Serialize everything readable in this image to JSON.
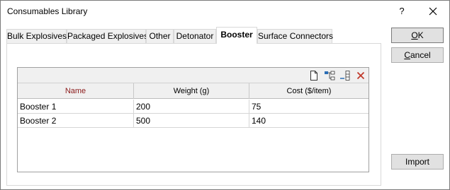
{
  "window": {
    "title": "Consumables Library"
  },
  "titlebar": {
    "help_label": "?"
  },
  "tabs": [
    {
      "label": "Bulk Explosives"
    },
    {
      "label": "Packaged Explosives"
    },
    {
      "label": "Other"
    },
    {
      "label": "Detonator"
    },
    {
      "label": "Booster"
    },
    {
      "label": "Surface Connectors"
    }
  ],
  "active_tab": "Booster",
  "grid": {
    "toolbar": [
      "new-icon",
      "tree-icon",
      "column-icon",
      "delete-icon"
    ],
    "columns": [
      "Name",
      "Weight (g)",
      "Cost ($/item)"
    ],
    "rows": [
      [
        "Booster 1",
        "200",
        "75"
      ],
      [
        "Booster 2",
        "500",
        "140"
      ]
    ]
  },
  "buttons": {
    "ok_first": "O",
    "ok_rest": "K",
    "cancel_first": "C",
    "cancel_rest": "ancel",
    "import": "Import"
  },
  "colors": {
    "name_header": "#8b1a1a",
    "delete_icon": "#c0392b",
    "tree_icon": "#2a6db5"
  }
}
